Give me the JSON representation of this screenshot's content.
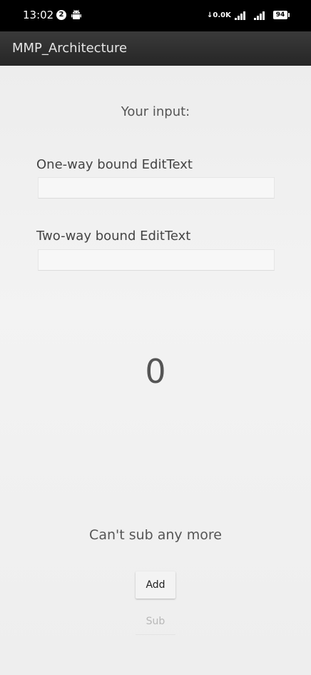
{
  "status_bar": {
    "time": "13:02",
    "notification_count": "2",
    "net_speed": "0.0K",
    "battery_level": "94"
  },
  "app_bar": {
    "title": "MMP_Architecture"
  },
  "main": {
    "input_header": "Your input:",
    "one_way": {
      "label": "One-way bound EditText",
      "value": ""
    },
    "two_way": {
      "label": "Two-way bound EditText",
      "value": ""
    },
    "counter_value": "0",
    "status_message": "Can't sub any more",
    "add_label": "Add",
    "sub_label": "Sub"
  },
  "colors": {
    "status_bar_bg": "#000000",
    "app_bar_bg": "#2f2f2f",
    "content_bg": "#f0f0f0",
    "disabled_text": "#b8b8b8"
  }
}
